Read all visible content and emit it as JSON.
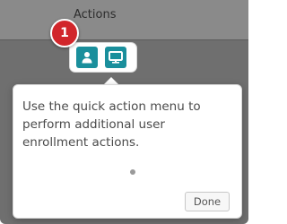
{
  "table": {
    "column_header": "Actions"
  },
  "quick_actions": [
    {
      "icon": "user-icon"
    },
    {
      "icon": "monitor-icon"
    }
  ],
  "step_badge": "1",
  "popover": {
    "message": "Use the quick action menu to perform additional user enrollment actions.",
    "done_label": "Done",
    "pages": 1,
    "current_page": 1
  },
  "colors": {
    "accent": "#1a8f9c",
    "badge": "#d1262b",
    "overlay": "#6f6f6f"
  }
}
